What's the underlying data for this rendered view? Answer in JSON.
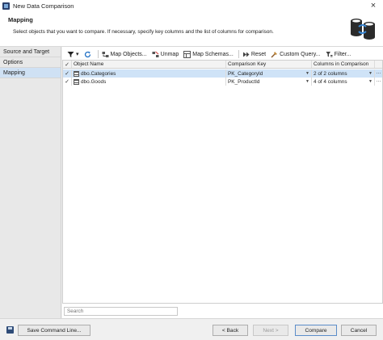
{
  "window": {
    "title": "New Data Comparison",
    "close_glyph": "×"
  },
  "header": {
    "title": "Mapping",
    "description": "Select objects that you want to compare. If necessary, specify key columns and the list of columns for comparison."
  },
  "sidebar": {
    "items": [
      {
        "label": "Source and Target",
        "active": false
      },
      {
        "label": "Options",
        "active": false
      },
      {
        "label": "Mapping",
        "active": true
      }
    ]
  },
  "toolbar": {
    "filter_dropdown": "▾",
    "map_objects": "Map Objects...",
    "unmap": "Unmap",
    "map_schemas": "Map Schemas...",
    "reset": "Reset",
    "custom_query": "Custom Query...",
    "filter": "Filter..."
  },
  "grid": {
    "columns": [
      "Object Name",
      "Comparison Key",
      "Columns in Comparison"
    ],
    "header_check": "✓",
    "rows": [
      {
        "checked": "✓",
        "name": "dbo.Categories",
        "key": "PK_CategoryId",
        "columns": "2 of 2 columns",
        "selected": true,
        "more": "···"
      },
      {
        "checked": "✓",
        "name": "dbo.Goods",
        "key": "PK_ProductId",
        "columns": "4 of 4 columns",
        "selected": false,
        "more": "···"
      }
    ]
  },
  "search": {
    "placeholder": "Search"
  },
  "footer": {
    "save_command_line": "Save Command Line...",
    "back": "< Back",
    "next": "Next >",
    "compare": "Compare",
    "cancel": "Cancel"
  }
}
